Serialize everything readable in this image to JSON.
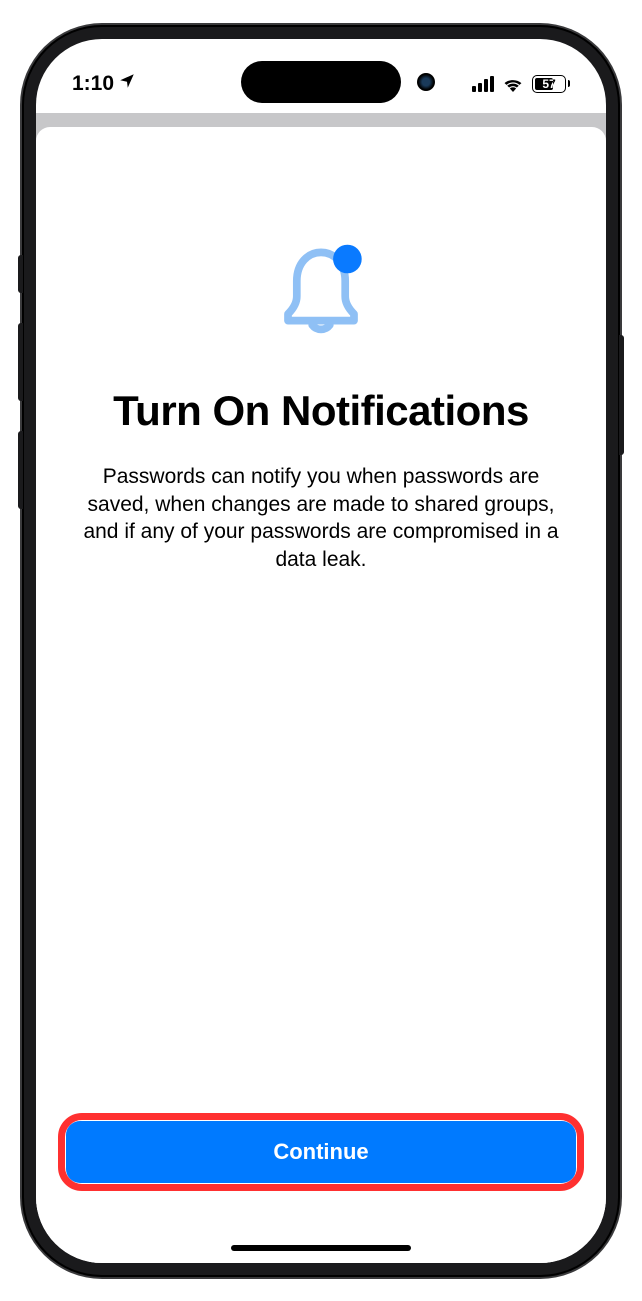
{
  "status_bar": {
    "time": "1:10",
    "battery_percent": "57"
  },
  "content": {
    "title": "Turn On Notifications",
    "description": "Passwords can notify you when passwords are saved, when changes are made to shared groups, and if any of your passwords are compromised in a data leak."
  },
  "buttons": {
    "continue_label": "Continue"
  },
  "colors": {
    "primary_blue": "#007aff",
    "highlight_red": "#ff3030",
    "icon_light_blue": "#8fc0f5",
    "icon_dot_blue": "#0a7aff"
  }
}
